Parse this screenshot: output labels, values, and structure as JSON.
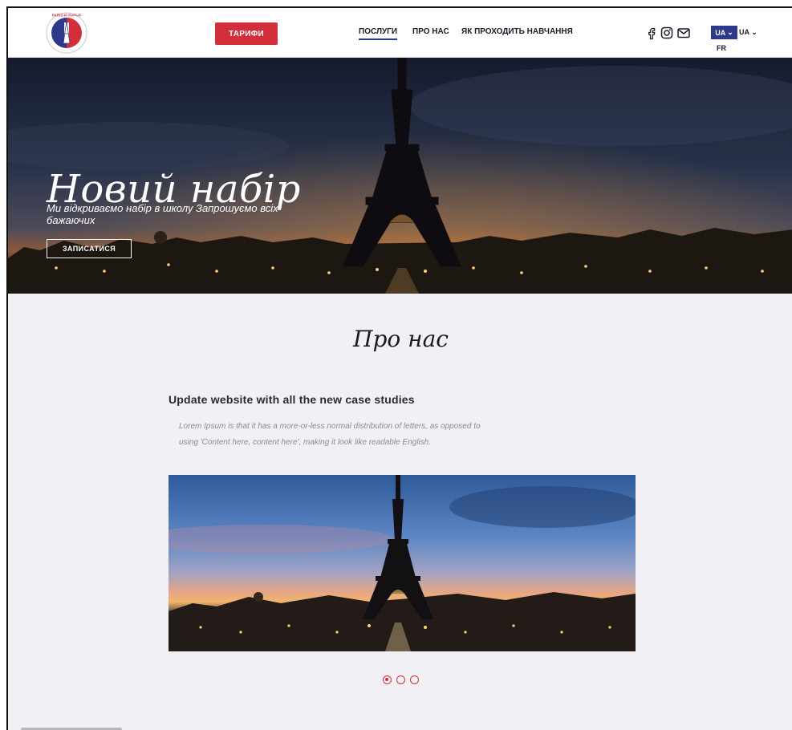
{
  "header": {
    "logo_text": "PARIS-IF PAPI-IF",
    "tariffs_label": "ТАРИФИ",
    "nav": [
      {
        "label": "ПОСЛУГИ"
      },
      {
        "label": "ПРО НАС"
      },
      {
        "label": "ЯК ПРОХОДИТЬ НАВЧАННЯ"
      }
    ],
    "social_icons": [
      "facebook-icon",
      "instagram-icon",
      "mail-icon"
    ],
    "lang_active": "UA",
    "lang_select": "UA",
    "lang_other": "FR",
    "accent_color": "#2d3a8c",
    "brand_red": "#d32f3a"
  },
  "hero": {
    "title": "Новий набір",
    "subtitle": "Ми відкриваємо набір в школу Запрошуємо всіх бажаючих",
    "button_label": "ЗАПИСАТИСЯ"
  },
  "about": {
    "title": "Про нас",
    "card_title": "Update website with all the new case studies",
    "card_desc": "Lorem Ipsum is that it has a more-or-less normal distribution of letters, as opposed to using 'Content here, content here', making it look like readable English.",
    "slider_count": 3,
    "slider_active": 1
  }
}
